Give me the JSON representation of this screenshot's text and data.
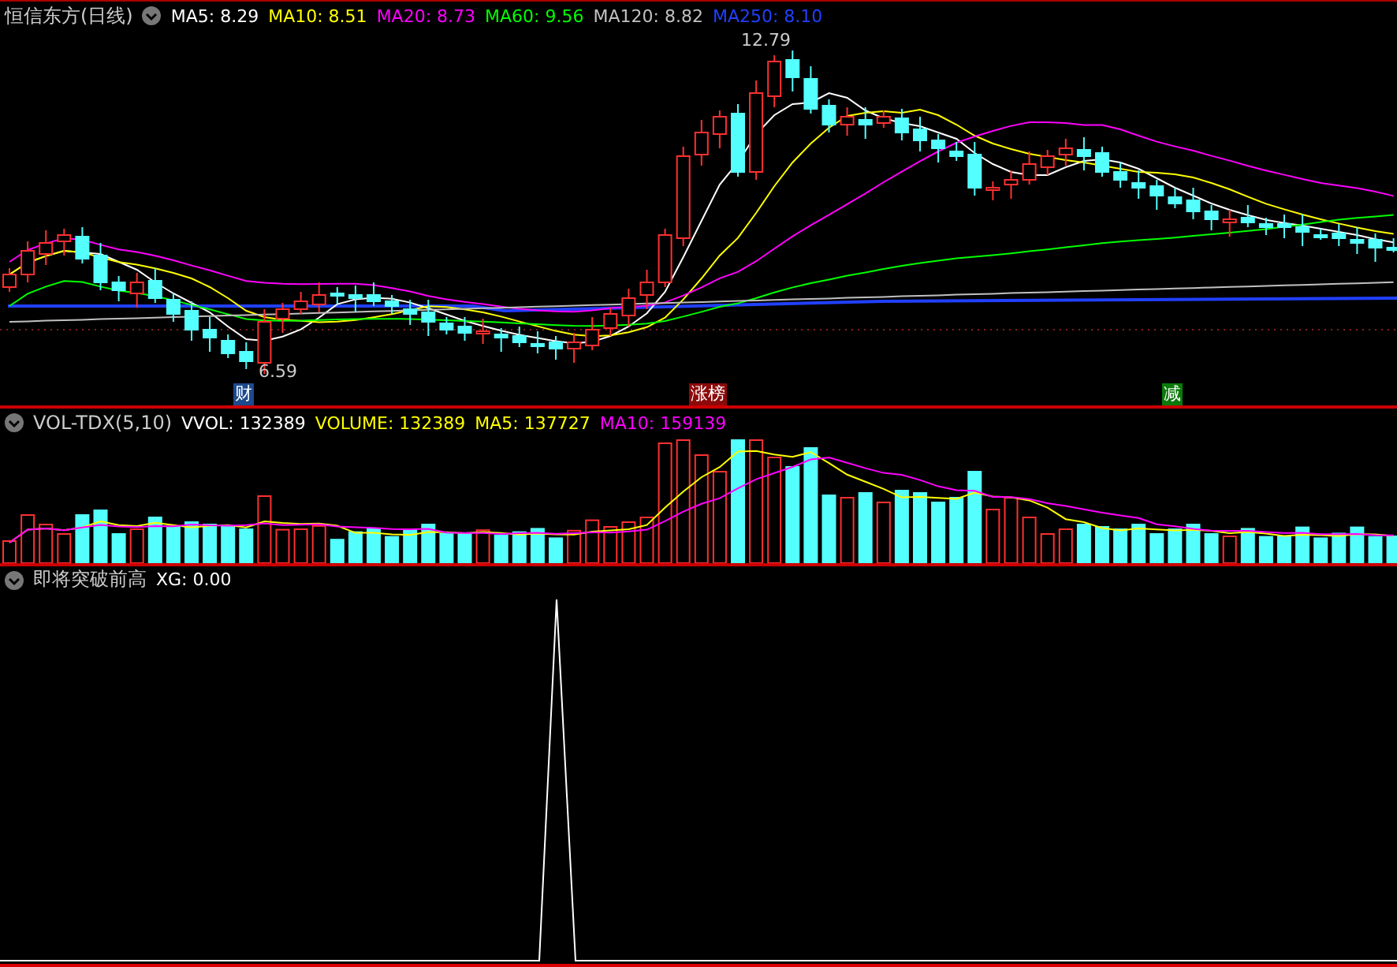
{
  "main_panel": {
    "title": "恒信东方(日线)",
    "indicators": [
      {
        "label": "MA5: 8.29",
        "color": "#ffffff"
      },
      {
        "label": "MA10: 8.51",
        "color": "#ffff00"
      },
      {
        "label": "MA20: 8.73",
        "color": "#ff00ff"
      },
      {
        "label": "MA60: 9.56",
        "color": "#00ff00"
      },
      {
        "label": "MA120: 8.82",
        "color": "#c0c0c0"
      },
      {
        "label": "MA250: 8.10",
        "color": "#2040ff"
      }
    ],
    "low_label": "6.59",
    "high_label": "12.79",
    "markers": [
      {
        "text": "财",
        "color": "#1c4a8c"
      },
      {
        "text": "涨榜",
        "color": "#8b0a0a"
      },
      {
        "text": "减",
        "color": "#0b7a0b"
      }
    ]
  },
  "volume_panel": {
    "title": "VOL-TDX(5,10)",
    "indicators": [
      {
        "label": "VVOL: 132389",
        "color": "#ffffff"
      },
      {
        "label": "VOLUME: 132389",
        "color": "#ffff00"
      },
      {
        "label": "MA5: 137727",
        "color": "#ffff00"
      },
      {
        "label": "MA10: 159139",
        "color": "#ff00ff"
      }
    ]
  },
  "signal_panel": {
    "title": "即将突破前高",
    "indicators": [
      {
        "label": "XG: 0.00",
        "color": "#ffffff"
      }
    ]
  }
}
